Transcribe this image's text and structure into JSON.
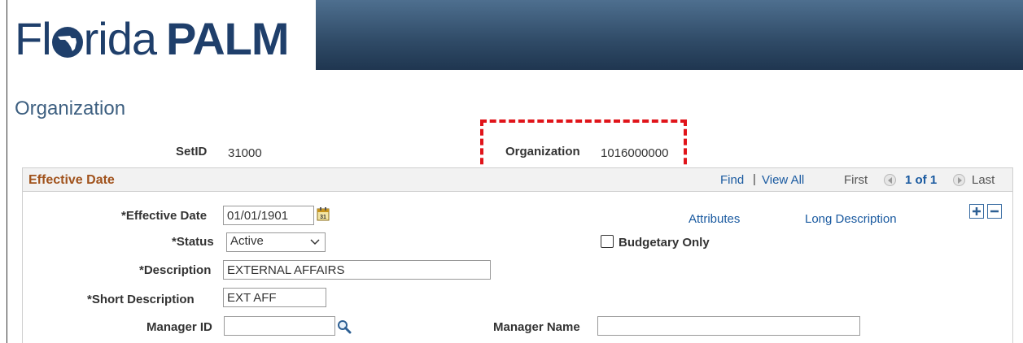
{
  "header": {
    "logo_part1": "Fl",
    "logo_part2": "rida",
    "logo_part3": "PALM"
  },
  "page_title": "Organization",
  "key_fields": {
    "setid_label": "SetID",
    "setid_value": "31000",
    "org_label": "Organization",
    "org_value": "1016000000"
  },
  "grid_header": {
    "title": "Effective Date",
    "find": "Find",
    "separator": "|",
    "view_all": "View All",
    "first": "First",
    "counter": "1 of 1",
    "last": "Last"
  },
  "form": {
    "effective_date_label": "*Effective Date",
    "effective_date_value": "01/01/1901",
    "status_label": "*Status",
    "status_value": "Active",
    "description_label": "*Description",
    "description_value": "EXTERNAL AFFAIRS",
    "short_description_label": "*Short Description",
    "short_description_value": "EXT AFF",
    "manager_id_label": "Manager ID",
    "manager_id_value": "",
    "manager_name_label": "Manager Name",
    "manager_name_value": "",
    "attributes_link": "Attributes",
    "long_description_link": "Long Description",
    "budgetary_only_label": "Budgetary Only",
    "budgetary_only_checked": false
  },
  "colors": {
    "banner": "#2f4a66",
    "logo": "#1f3f6b",
    "title": "#3d5f80",
    "section_title": "#a0521c",
    "link": "#1a5aa0",
    "highlight": "#e0141a"
  }
}
